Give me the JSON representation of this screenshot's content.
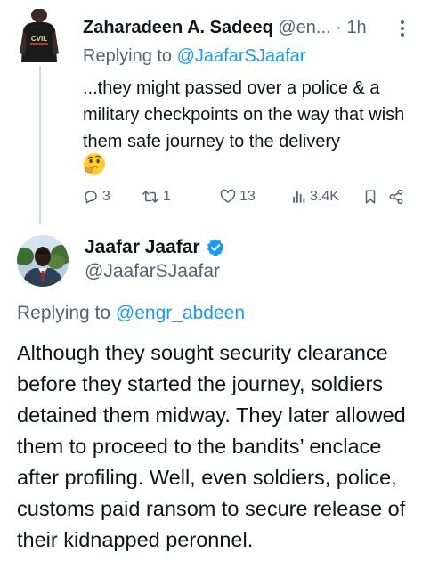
{
  "reply_tweet": {
    "author_name": "Zaharadeen A. Sadeeq",
    "author_handle": "@en...",
    "separator": "·",
    "time": "1h",
    "replying_prefix": "Replying to ",
    "replying_to": "@JaafarSJaafar",
    "text": "...they might passed over a police & a military checkpoints on the way that wish them safe journey to the delivery",
    "emoji": "thinking-face",
    "avatar_shirt_text": "CVIL",
    "metrics": {
      "replies": "3",
      "retweets": "1",
      "likes": "13",
      "views": "3.4K"
    }
  },
  "main_tweet": {
    "author_name": "Jaafar Jaafar",
    "author_handle": "@JaafarSJaafar",
    "verified": true,
    "replying_prefix": "Replying to ",
    "replying_to": "@engr_abdeen",
    "text": "Although they sought security clearance before they started the journey, soldiers detained them midway. They later allowed them to proceed to the bandits’ enclace after profiling. Well, even soldiers, police, customs paid ransom to secure release of their kidnapped peronnel."
  },
  "colors": {
    "link": "#1d9bf0",
    "secondary_text": "#536471",
    "primary_text": "#0f1419",
    "thread_line": "#cfd9de"
  }
}
